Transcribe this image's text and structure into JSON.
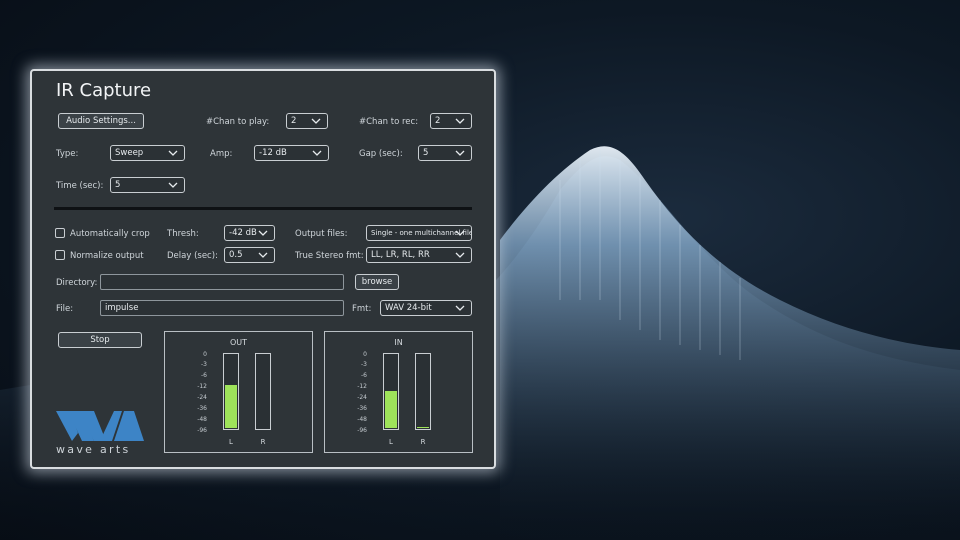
{
  "window": {
    "title": "IR Capture"
  },
  "row1": {
    "audio_settings_label": "Audio Settings...",
    "chan_play_label": "#Chan to play:",
    "chan_play_value": "2",
    "chan_rec_label": "#Chan to rec:",
    "chan_rec_value": "2"
  },
  "row2": {
    "type_label": "Type:",
    "type_value": "Sweep",
    "amp_label": "Amp:",
    "amp_value": "-12 dB",
    "gap_label": "Gap (sec):",
    "gap_value": "5"
  },
  "row3": {
    "time_label": "Time (sec):",
    "time_value": "5"
  },
  "options": {
    "auto_crop_label": "Automatically crop",
    "auto_crop_checked": false,
    "normalize_label": "Normalize output",
    "normalize_checked": false,
    "thresh_label": "Thresh:",
    "thresh_value": "-42 dB",
    "delay_label": "Delay (sec):",
    "delay_value": "0.5",
    "output_files_label": "Output files:",
    "output_files_value": "Single - one multichannel file",
    "true_stereo_label": "True Stereo fmt:",
    "true_stereo_value": "LL, LR, RL, RR"
  },
  "files": {
    "directory_label": "Directory:",
    "directory_value": "",
    "browse_label": "browse",
    "file_label": "File:",
    "file_value": "impulse",
    "fmt_label": "Fmt:",
    "fmt_value": "WAV 24-bit"
  },
  "transport": {
    "stop_label": "Stop"
  },
  "meters": {
    "scale": [
      "0",
      "-3",
      "-6",
      "-12",
      "-24",
      "-36",
      "-48",
      "-96"
    ],
    "out": {
      "title": "OUT",
      "left_label": "L",
      "right_label": "R",
      "left_level": 0.58,
      "right_level": 0.0
    },
    "in": {
      "title": "IN",
      "left_label": "L",
      "right_label": "R",
      "left_level": 0.49,
      "right_level": 0.02
    }
  },
  "colors": {
    "meter_fill": "#9ee35a",
    "logo_blue": "#3d84c6",
    "panel_bg": "#2e3438"
  },
  "logo": {
    "text": "wave arts"
  }
}
